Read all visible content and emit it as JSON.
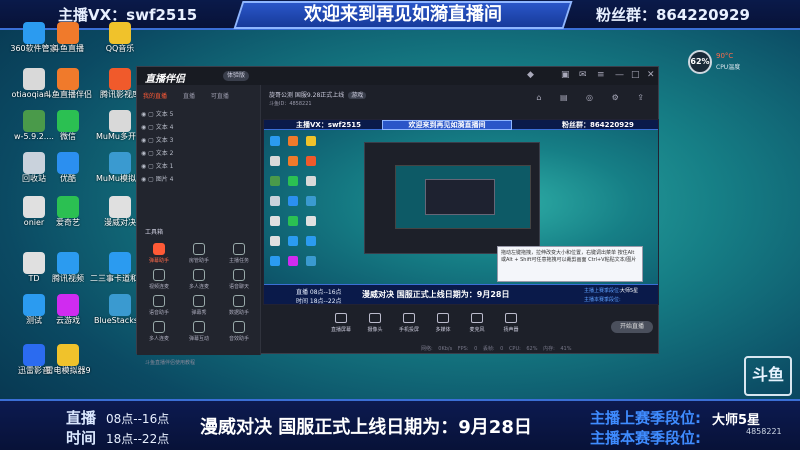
{
  "top_banner": {
    "left": "主播VX：swf2515",
    "center": "欢迎来到再见如漪直播间",
    "right": "粉丝群：864220929"
  },
  "desktop_icons": [
    {
      "label": "360软件管家",
      "color": "#2b9bf0"
    },
    {
      "label": "斗鱼直播",
      "color": "#f07a2b"
    },
    {
      "label": "QQ音乐",
      "color": "#f0c22b"
    },
    {
      "label": "otiaoqian...",
      "color": "#d9d9d9"
    },
    {
      "label": "斗鱼直播伴侣",
      "color": "#f07a2b"
    },
    {
      "label": "腾讯影视库",
      "color": "#f05a2b"
    },
    {
      "label": "w-5.9.2....",
      "color": "#4a9a4a"
    },
    {
      "label": "微信",
      "color": "#2bc052"
    },
    {
      "label": "MuMu多开器",
      "color": "#d9d9d9"
    },
    {
      "label": "回收站",
      "color": "#c9d2dc"
    },
    {
      "label": "优酷",
      "color": "#2b8ff0"
    },
    {
      "label": "MuMu模拟器",
      "color": "#3a9ad0"
    },
    {
      "label": "onier",
      "color": "#e0e0e0"
    },
    {
      "label": "爱奇艺",
      "color": "#2bc052"
    },
    {
      "label": "漫威对决",
      "color": "#e0e0e0"
    },
    {
      "label": "TD",
      "color": "#e0e0e0"
    },
    {
      "label": "腾讯视频",
      "color": "#2b9bf0"
    },
    {
      "label": "二三事卡道和星卡",
      "color": "#2b9bf0"
    },
    {
      "label": "测试",
      "color": "#2b9bf0"
    },
    {
      "label": "云游戏",
      "color": "#d02bf0"
    },
    {
      "label": "BlueStacks X",
      "color": "#3a9ad0"
    },
    {
      "label": "迅雷影音",
      "color": "#2b6bf0"
    },
    {
      "label": "雷电模拟器9",
      "color": "#f0c22b"
    }
  ],
  "cpu_widget": {
    "percent": "62%",
    "temp": "90°C",
    "label": "CPU温度"
  },
  "app": {
    "logo": "直播伴侣",
    "version_pill": "体验版",
    "tabs": [
      "我的直播",
      "直播",
      "可直播"
    ],
    "sources": [
      "文本 5",
      "文本 4",
      "文本 3",
      "文本 2",
      "文本 1",
      "图片 4"
    ],
    "tools_title": "工具箱",
    "tools": [
      "弹幕助手",
      "房管助手",
      "主播任务",
      "视频连麦",
      "多人连麦",
      "语音聊天",
      "语音助手",
      "弹幕秀",
      "数据助手",
      "多人连麦",
      "弹幕互动",
      "音效助手"
    ],
    "footer_note": "斗鱼直播伴侣使用教程",
    "room_info": "旋哥公测  国服9.28正式上线",
    "room_tag": "游戏",
    "room_sub": "斗鱼ID：4858221",
    "controls": [
      "直播屏幕",
      "摄像头",
      "手机投屏",
      "多媒体",
      "麦克风",
      "扬声器"
    ],
    "live_button": "开始直播",
    "status_bar": "网络: 0Kb/s  FPS: 0  丢帧: 0  CPU: 62%  内存: 41%"
  },
  "preview": {
    "top_left": "主播VX：swf2515",
    "top_center": "欢迎来到再见如漪直播间",
    "top_right": "粉丝群：864220929",
    "tooltip": "拖动左键拖拽，拉伸改变大小和位置，右键调出菜单 按住Alt或Alt + Shift可任意拖拽可以裁剪画面 Ctrl+V粘贴文本/图片",
    "bottom_l1": "直播 08点--16点",
    "bottom_l2": "时间 18点--22点",
    "bottom_mid": "漫威对决  国服正式上线日期为：9月28日",
    "bottom_r1": "主播上赛季段位:",
    "bottom_r2": "主播本赛季段位:",
    "bottom_rank": "大师5星"
  },
  "side_logo": "斗鱼",
  "ticker": {
    "live_label": "直播",
    "time_label": "时间",
    "slot1": "08点--16点",
    "slot2": "18点--22点",
    "announcement": "漫威对决  国服正式上线日期为：9月28日",
    "last_season": "主播上赛季段位:",
    "this_season": "主播本赛季段位:",
    "rank": "大师5星",
    "room_id": "4858221"
  }
}
